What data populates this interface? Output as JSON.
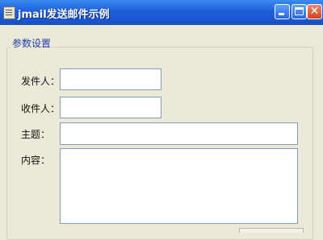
{
  "window": {
    "title": "jmail发送邮件示例"
  },
  "group": {
    "title": "参数设置"
  },
  "form": {
    "sender_label": "发件人：",
    "receiver_label": "收件人：",
    "subject_label": "主题：",
    "content_label": "内容：",
    "sender_value": "",
    "receiver_value": "",
    "subject_value": "",
    "content_value": ""
  },
  "icons": {
    "minimize": "minimize-icon",
    "maximize": "maximize-icon",
    "close": "close-icon",
    "app": "app-icon"
  }
}
